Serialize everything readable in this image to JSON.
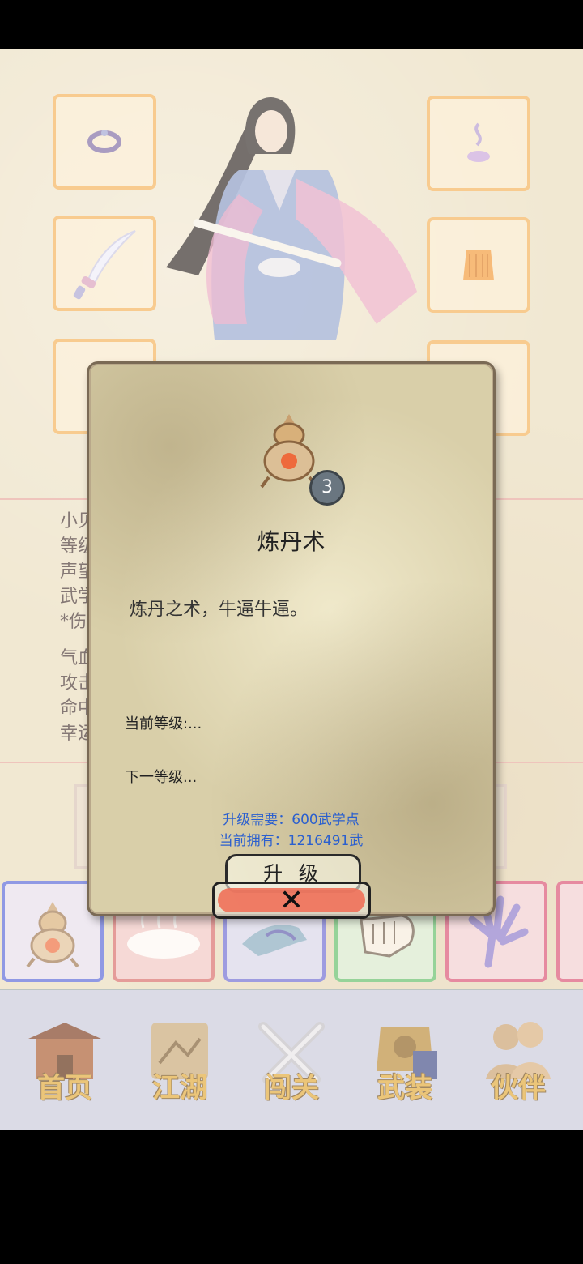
{
  "equipment": {
    "slots": [
      "ring",
      "incense",
      "sword",
      "armor",
      "slot-5",
      "slot-6"
    ]
  },
  "stats_partial": [
    "小贝",
    "等级",
    "声望",
    "武学",
    "*伤",
    "气血",
    "攻击",
    "命中",
    "幸运"
  ],
  "dialog": {
    "level": "3",
    "title": "炼丹术",
    "description": "炼丹之术，牛逼牛逼。",
    "current_level": "当前等级:...",
    "next_level": "下一等级...",
    "upgrade_requirement": "升级需要：600武学点",
    "current_owned": "当前拥有：1216491武",
    "upgrade_button": "升 级"
  },
  "close_button": "✕",
  "skill_bar": [
    {
      "name": "alchemy",
      "border": "#5566dd",
      "bg": "#e6e0f2"
    },
    {
      "name": "mist",
      "border": "#d86a6a",
      "bg": "#f1c8c8"
    },
    {
      "name": "hand-blue",
      "border": "#6b6bd8",
      "bg": "#d8d7ef"
    },
    {
      "name": "fist",
      "border": "#5fbf6a",
      "bg": "#d8ecd2"
    },
    {
      "name": "claw",
      "border": "#d94f76",
      "bg": "#f2cfd6"
    },
    {
      "name": "leaf",
      "border": "#d94f76",
      "bg": "#f2cfd6"
    }
  ],
  "nav": {
    "items": [
      {
        "label": "首页",
        "icon": "temple-icon"
      },
      {
        "label": "江湖",
        "icon": "scroll-map-icon"
      },
      {
        "label": "闯关",
        "icon": "crossed-swords-icon"
      },
      {
        "label": "武装",
        "icon": "armor-icon"
      },
      {
        "label": "伙伴",
        "icon": "companions-icon"
      }
    ]
  }
}
